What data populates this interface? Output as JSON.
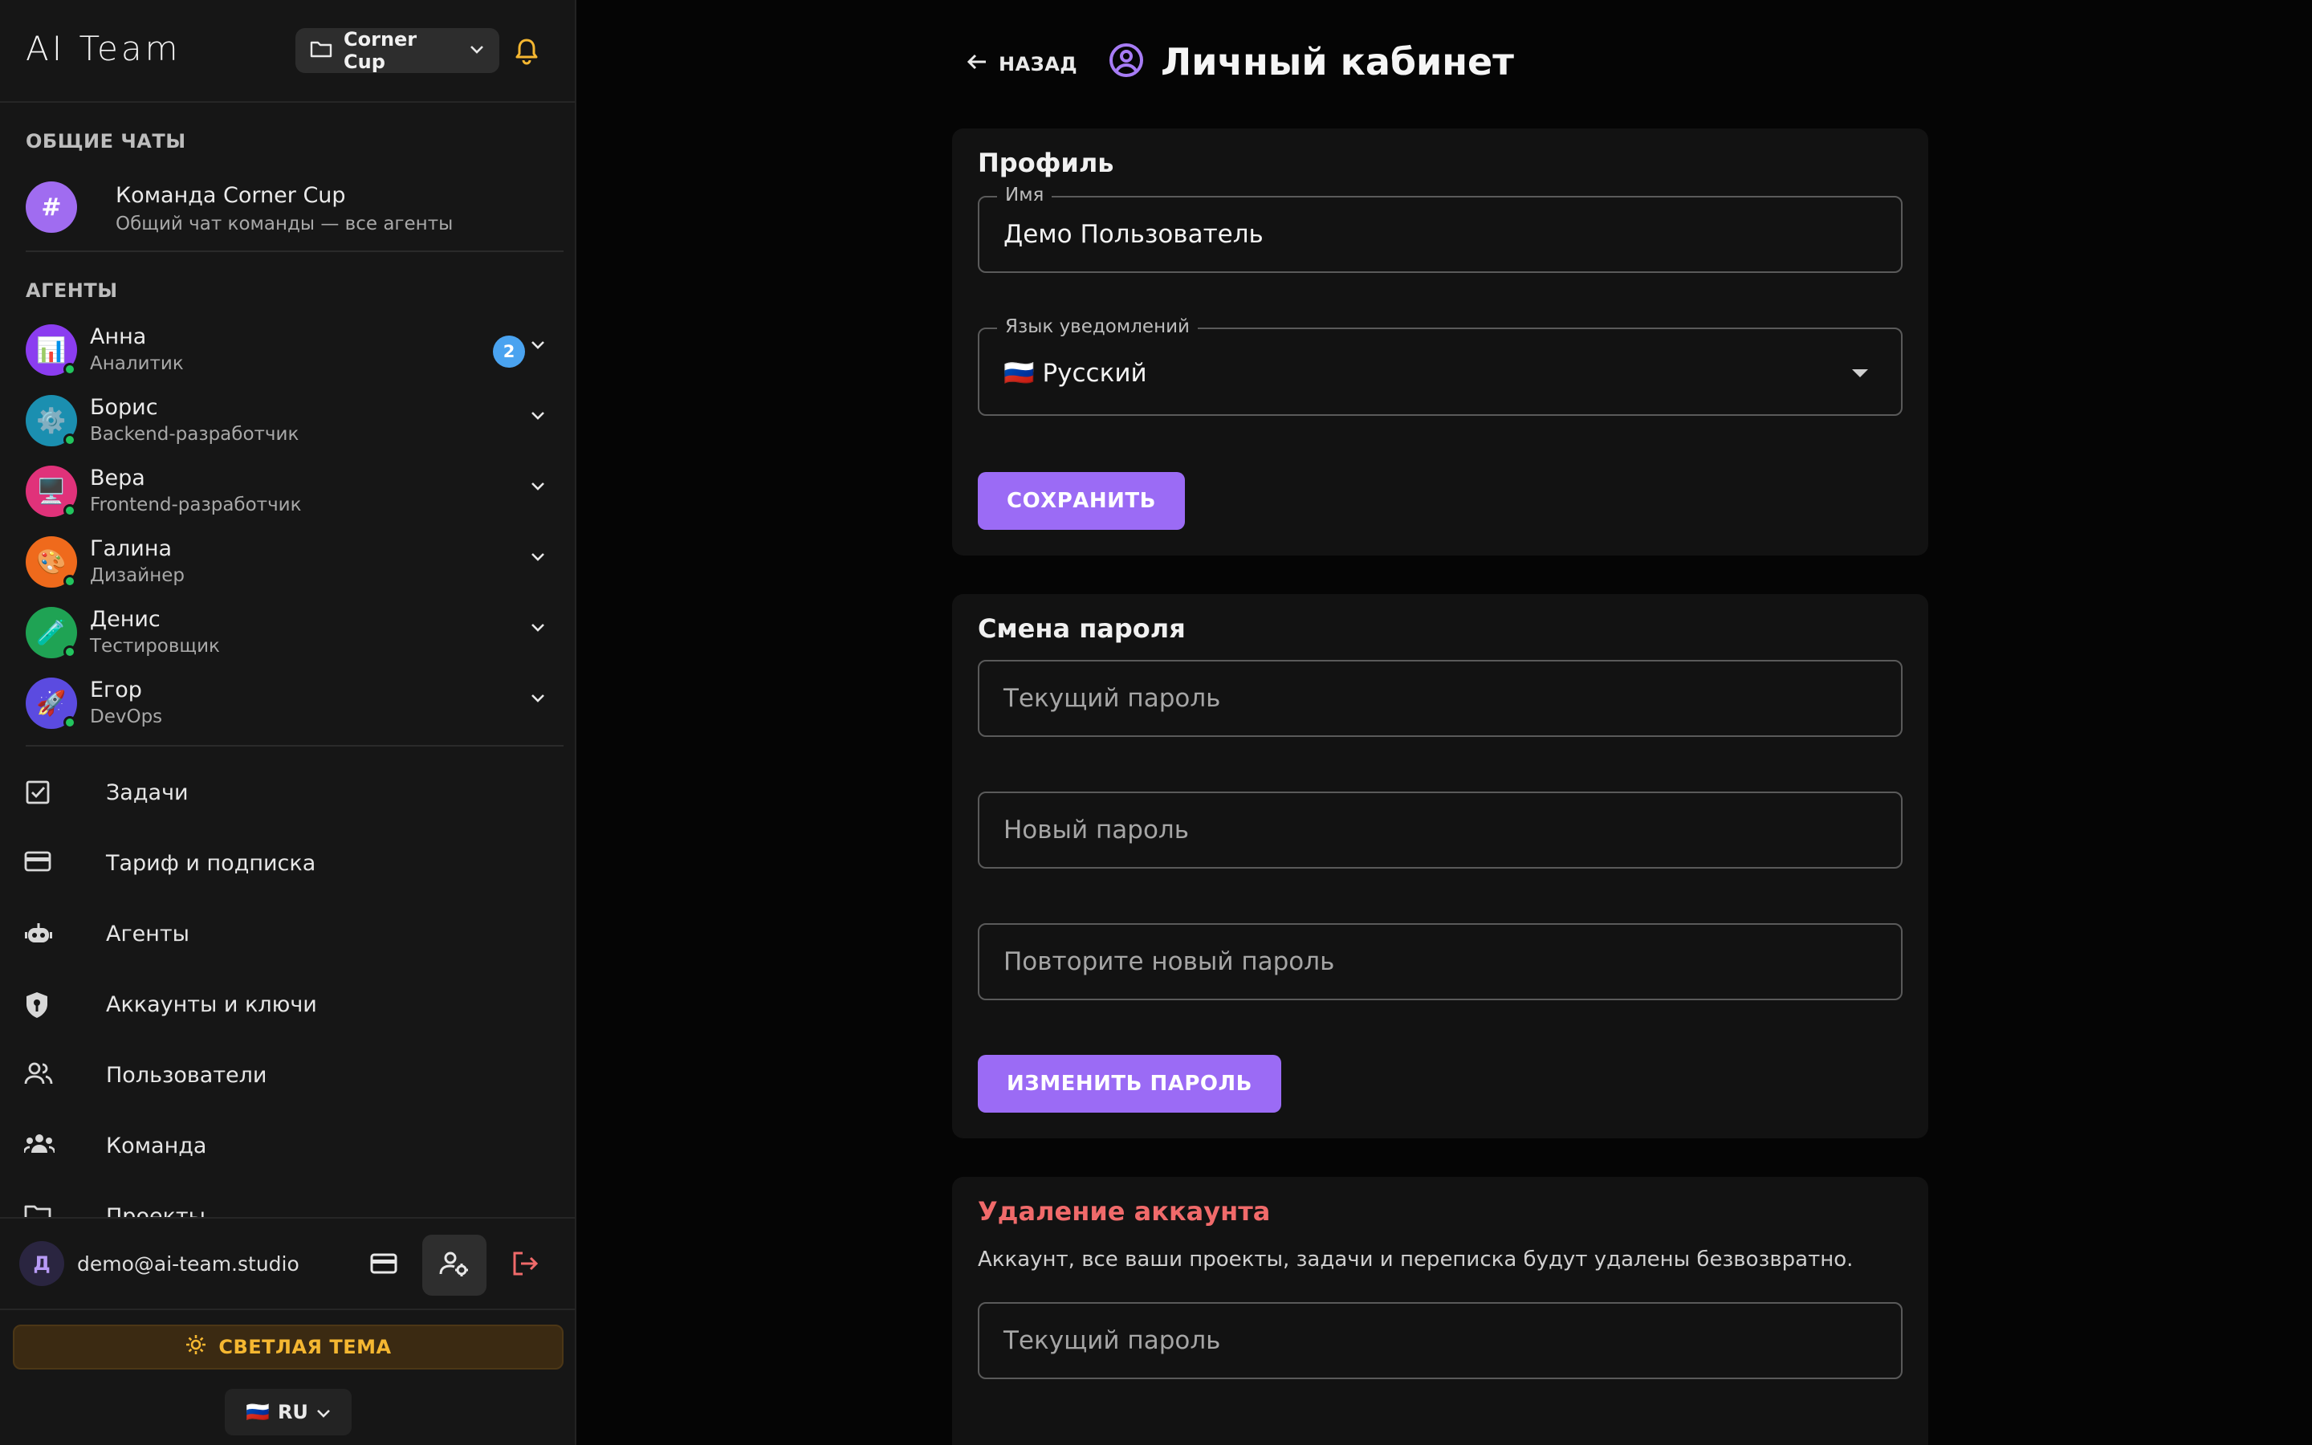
{
  "app": {
    "title": "AI Team"
  },
  "project_selector": {
    "label": "Corner Cup"
  },
  "sidebar": {
    "section_chats": "ОБЩИЕ ЧАТЫ",
    "team_chat": {
      "avatar": "#",
      "title": "Команда Corner Cup",
      "subtitle": "Общий чат команды — все агенты"
    },
    "section_agents": "АГЕНТЫ",
    "agents": [
      {
        "name": "Анна",
        "role": "Аналитик",
        "emoji": "📊",
        "color": "#8b3df0",
        "unread": "2"
      },
      {
        "name": "Борис",
        "role": "Backend-разработчик",
        "emoji": "⚙️",
        "color": "#1b8fb0",
        "unread": ""
      },
      {
        "name": "Вера",
        "role": "Frontend-разработчик",
        "emoji": "🖥️",
        "color": "#e0327a",
        "unread": ""
      },
      {
        "name": "Галина",
        "role": "Дизайнер",
        "emoji": "🎨",
        "color": "#ef6a1c",
        "unread": ""
      },
      {
        "name": "Денис",
        "role": "Тестировщик",
        "emoji": "🧪",
        "color": "#1fa354",
        "unread": ""
      },
      {
        "name": "Егор",
        "role": "DevOps",
        "emoji": "🚀",
        "color": "#5b4be0",
        "unread": ""
      }
    ],
    "nav": [
      {
        "label": "Задачи",
        "icon": "checkbox-icon"
      },
      {
        "label": "Тариф и подписка",
        "icon": "credit-card-icon"
      },
      {
        "label": "Агенты",
        "icon": "robot-icon"
      },
      {
        "label": "Аккаунты и ключи",
        "icon": "shield-key-icon"
      },
      {
        "label": "Пользователи",
        "icon": "users-icon"
      },
      {
        "label": "Команда",
        "icon": "team-icon"
      },
      {
        "label": "Проекты",
        "icon": "folder-icon"
      }
    ],
    "footer": {
      "user_initial": "Д",
      "user_email": "demo@ai-team.studio",
      "theme_button": "СВЕТЛАЯ ТЕМА",
      "language_button": "RU",
      "language_flag": "🇷🇺"
    }
  },
  "main": {
    "back_label": "НАЗАД",
    "page_title": "Личный кабинет",
    "profile": {
      "title": "Профиль",
      "name_label": "Имя",
      "name_value": "Демо Пользователь",
      "lang_label": "Язык уведомлений",
      "lang_flag": "🇷🇺",
      "lang_value": "Русский",
      "save_button": "СОХРАНИТЬ"
    },
    "password": {
      "title": "Смена пароля",
      "current_placeholder": "Текущий пароль",
      "new_placeholder": "Новый пароль",
      "repeat_placeholder": "Повторите новый пароль",
      "change_button": "ИЗМЕНИТЬ ПАРОЛЬ"
    },
    "delete": {
      "title": "Удаление аккаунта",
      "note": "Аккаунт, все ваши проекты, задачи и переписка будут удалены безвозвратно.",
      "current_placeholder": "Текущий пароль"
    }
  },
  "colors": {
    "accent": "#9b6bf5",
    "danger": "#f06a6a",
    "warning": "#f5b731",
    "online": "#22c55e"
  }
}
